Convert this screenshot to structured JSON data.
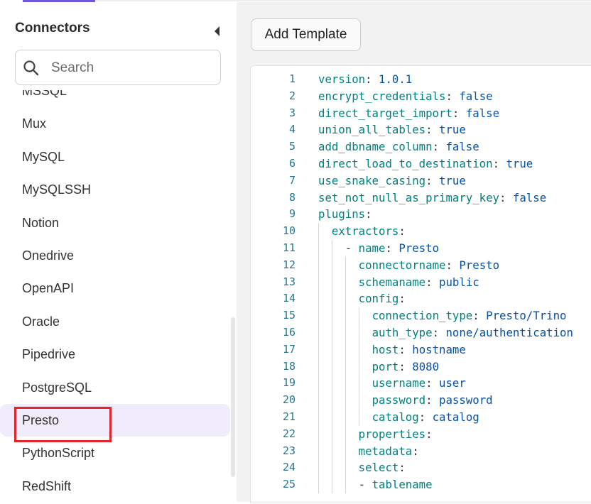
{
  "sidebar": {
    "title": "Connectors",
    "search_placeholder": "Search",
    "items": [
      "MSSQL",
      "Mux",
      "MySQL",
      "MySQLSSH",
      "Notion",
      "Onedrive",
      "OpenAPI",
      "Oracle",
      "Pipedrive",
      "PostgreSQL",
      "Presto",
      "PythonScript",
      "RedShift"
    ],
    "selected": "Presto"
  },
  "toolbar": {
    "add_template_label": "Add Template"
  },
  "editor": {
    "lines": [
      {
        "n": "1",
        "indent": 0,
        "dash": false,
        "key": "version",
        "value": "1.0.1"
      },
      {
        "n": "2",
        "indent": 0,
        "dash": false,
        "key": "encrypt_credentials",
        "value": "false"
      },
      {
        "n": "3",
        "indent": 0,
        "dash": false,
        "key": "direct_target_import",
        "value": "false"
      },
      {
        "n": "4",
        "indent": 0,
        "dash": false,
        "key": "union_all_tables",
        "value": "true"
      },
      {
        "n": "5",
        "indent": 0,
        "dash": false,
        "key": "add_dbname_column",
        "value": "false"
      },
      {
        "n": "6",
        "indent": 0,
        "dash": false,
        "key": "direct_load_to_destination",
        "value": "true"
      },
      {
        "n": "7",
        "indent": 0,
        "dash": false,
        "key": "use_snake_casing",
        "value": "true"
      },
      {
        "n": "8",
        "indent": 0,
        "dash": false,
        "key": "set_not_null_as_primary_key",
        "value": "false"
      },
      {
        "n": "9",
        "indent": 0,
        "dash": false,
        "key": "plugins",
        "value": ""
      },
      {
        "n": "10",
        "indent": 1,
        "dash": false,
        "key": "extractors",
        "value": ""
      },
      {
        "n": "11",
        "indent": 2,
        "dash": true,
        "key": "name",
        "value": "Presto"
      },
      {
        "n": "12",
        "indent": 3,
        "dash": false,
        "key": "connectorname",
        "value": "Presto"
      },
      {
        "n": "13",
        "indent": 3,
        "dash": false,
        "key": "schemaname",
        "value": "public"
      },
      {
        "n": "14",
        "indent": 3,
        "dash": false,
        "key": "config",
        "value": ""
      },
      {
        "n": "15",
        "indent": 4,
        "dash": false,
        "key": "connection_type",
        "value": "Presto/Trino"
      },
      {
        "n": "16",
        "indent": 4,
        "dash": false,
        "key": "auth_type",
        "value": "none/authentication"
      },
      {
        "n": "17",
        "indent": 4,
        "dash": false,
        "key": "host",
        "value": "hostname"
      },
      {
        "n": "18",
        "indent": 4,
        "dash": false,
        "key": "port",
        "value": "8080"
      },
      {
        "n": "19",
        "indent": 4,
        "dash": false,
        "key": "username",
        "value": "user"
      },
      {
        "n": "20",
        "indent": 4,
        "dash": false,
        "key": "password",
        "value": "password"
      },
      {
        "n": "21",
        "indent": 4,
        "dash": false,
        "key": "catalog",
        "value": "catalog"
      },
      {
        "n": "22",
        "indent": 3,
        "dash": false,
        "key": "properties",
        "value": ""
      },
      {
        "n": "23",
        "indent": 3,
        "dash": false,
        "key": "metadata",
        "value": ""
      },
      {
        "n": "24",
        "indent": 3,
        "dash": false,
        "key": "select",
        "value": ""
      },
      {
        "n": "25",
        "indent": 3,
        "dash": true,
        "key": "",
        "value": "tablename"
      }
    ]
  },
  "colors": {
    "accent": "#6b5bd6",
    "selected_bg": "#f0ecfb",
    "highlight_border": "#e0262b",
    "yaml_key": "#008080",
    "yaml_value": "#0451a5",
    "line_number": "#237893"
  },
  "icons": {
    "search": "search-icon",
    "collapse": "chevron-left-icon"
  }
}
